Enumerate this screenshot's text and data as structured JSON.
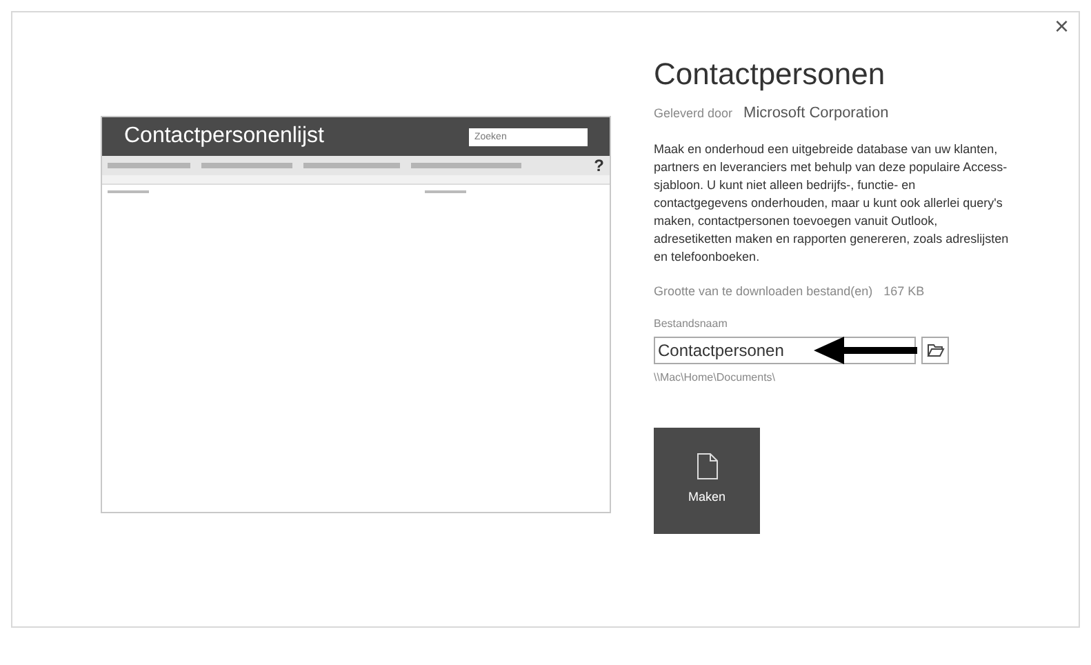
{
  "close": "×",
  "preview": {
    "title": "Contactpersonenlijst",
    "search": {
      "placeholder": "Zoeken"
    },
    "help": "?"
  },
  "template": {
    "title": "Contactpersonen",
    "provider_label": "Geleverd door",
    "provider": "Microsoft Corporation",
    "description": "Maak en onderhoud een uitgebreide database van uw klanten, partners en leveranciers met behulp van deze populaire Access-sjabloon. U kunt niet alleen bedrijfs-, functie- en contactgegevens onderhouden, maar u kunt ook allerlei query's maken, contactpersonen toevoegen vanuit Outlook, adresetiketten maken en rapporten genereren, zoals adreslijsten en telefoonboeken.",
    "size_label": "Grootte van te downloaden bestand(en)",
    "size": "167 KB",
    "file_label": "Bestandsnaam",
    "file_name": "Contactpersonen",
    "path": "\\\\Mac\\Home\\Documents\\",
    "create": "Maken"
  }
}
